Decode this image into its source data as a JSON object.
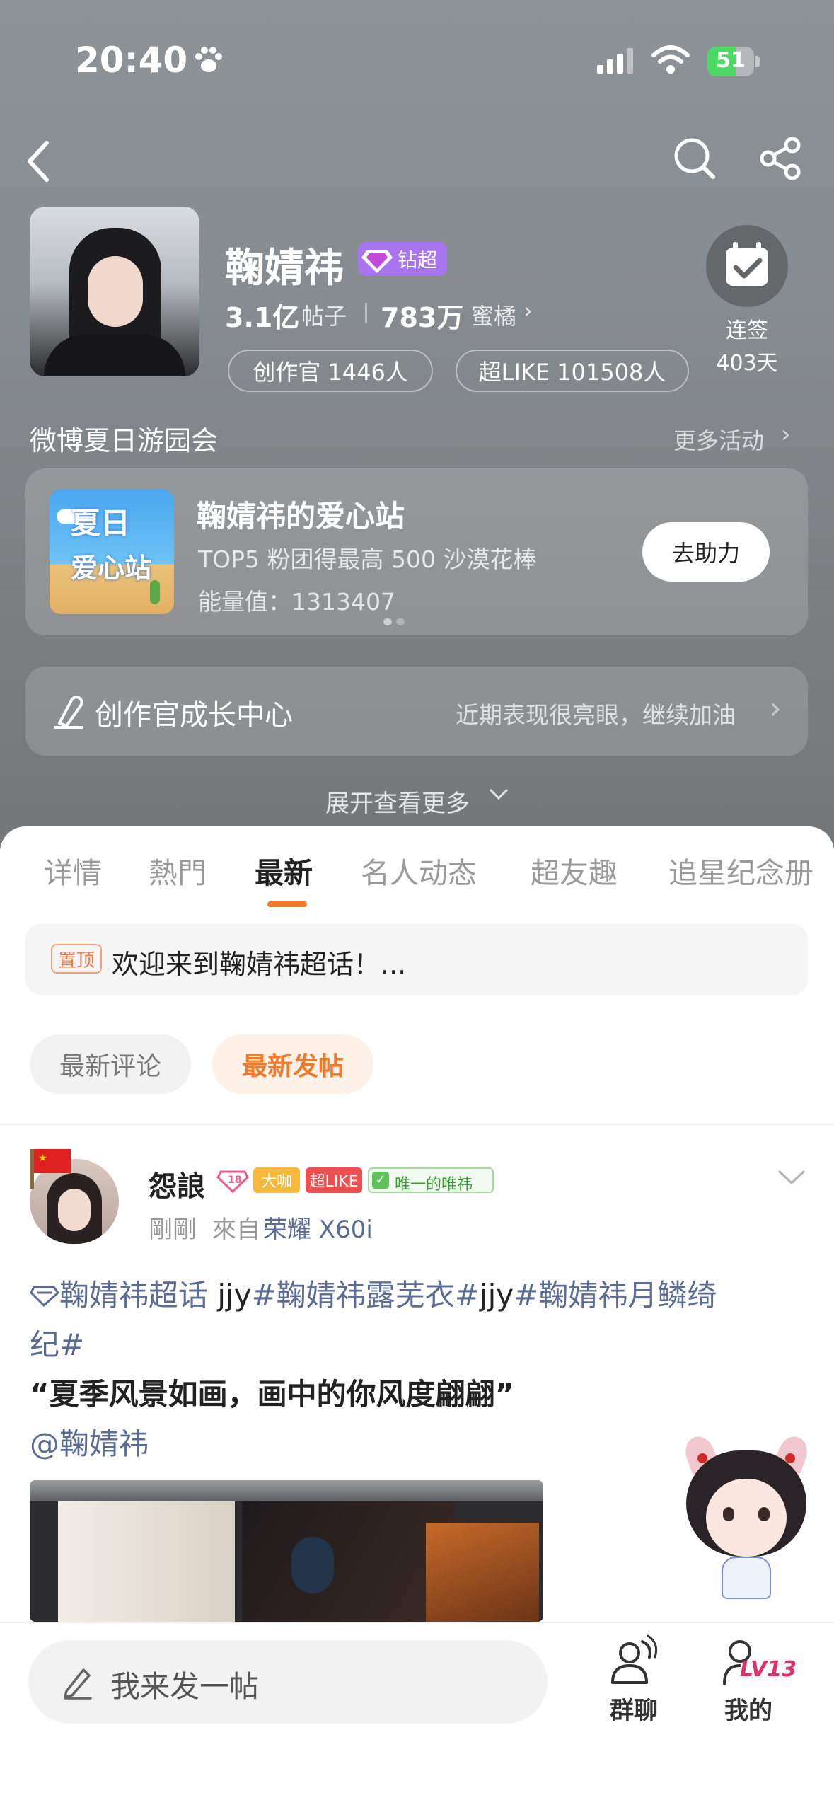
{
  "status_bar": {
    "time": "20:40",
    "battery": "51"
  },
  "profile": {
    "name": "鞠婧祎",
    "badge_label": "钻超",
    "posts_count": "3.1亿",
    "posts_label": "帖子",
    "fans_count": "783万",
    "fans_label": "蜜橘",
    "creator_pill": "创作官 1446人",
    "superlike_pill": "超LIKE 101508人",
    "checkin_label": "连签",
    "checkin_days": "403天"
  },
  "activity": {
    "section_title": "微博夏日游园会",
    "more_link": "更多活动",
    "thumb_line1": "夏日",
    "thumb_line2": "爱心站",
    "title": "鞠婧祎的爱心站",
    "desc": "TOP5 粉团得最高 500 沙漠花棒",
    "energy": "能量值：1313407",
    "button": "去助力"
  },
  "creator_center": {
    "title": "创作官成长中心",
    "hint": "近期表现很亮眼，继续加油"
  },
  "expand_label": "展开查看更多",
  "tabs": [
    {
      "label": "详情"
    },
    {
      "label": "熱門"
    },
    {
      "label": "最新"
    },
    {
      "label": "名人动态"
    },
    {
      "label": "超友趣"
    },
    {
      "label": "追星纪念册"
    }
  ],
  "pinned": {
    "tag": "置顶",
    "text": "欢迎来到鞠婧祎超话！..."
  },
  "filters": {
    "latest_comment": "最新评论",
    "latest_post": "最新发帖"
  },
  "post": {
    "author": "怨誏",
    "level_badge": "18",
    "badge_dk": "大咖",
    "badge_like": "超LIKE",
    "badge_fan": "唯一的唯祎",
    "time": "剛剛",
    "source_prefix": "來自",
    "source_device": "荣耀 X60i",
    "topic_tag": "鞠婧祎超话",
    "text_plain1": "jjy",
    "hashtag1": "#鞠婧祎露芜衣#",
    "text_plain2": "jjy",
    "hashtag2_line1": "#鞠婧祎月鳞绮",
    "hashtag2_line2": "纪#",
    "quote": "“夏季风景如画，画中的你风度翩翩”",
    "mention": "@鞠婧祎"
  },
  "bottom_bar": {
    "compose_placeholder": "我来发一帖",
    "group_chat": "群聊",
    "mine": "我的",
    "level": "LV13"
  },
  "colors": {
    "accent_orange": "#f07a28",
    "topic_blue": "#5b6d95",
    "hero_gray": "#878c90",
    "vip_purple": "#9b5cf6"
  }
}
